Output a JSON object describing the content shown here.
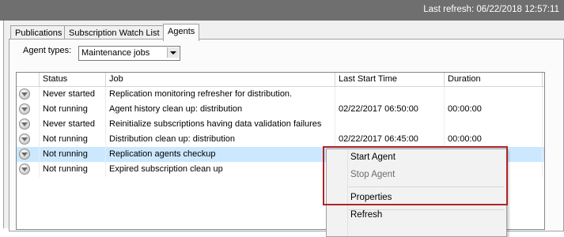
{
  "header": {
    "last_refresh": "Last refresh: 06/22/2018 12:57:11"
  },
  "tabs": [
    {
      "label": "Publications",
      "active": false
    },
    {
      "label": "Subscription Watch List",
      "active": false
    },
    {
      "label": "Agents",
      "active": true
    }
  ],
  "filter": {
    "label": "Agent types:",
    "selected": "Maintenance jobs"
  },
  "grid": {
    "columns": [
      "",
      "Status",
      "Job",
      "Last Start Time",
      "Duration"
    ],
    "rows": [
      {
        "status": "Never started",
        "job": "Replication monitoring refresher for distribution.",
        "last_start": "",
        "duration": "",
        "selected": false
      },
      {
        "status": "Not running",
        "job": "Agent history clean up: distribution",
        "last_start": "02/22/2017 06:50:00",
        "duration": "00:00:00",
        "selected": false
      },
      {
        "status": "Never started",
        "job": "Reinitialize subscriptions having data validation failures",
        "last_start": "",
        "duration": "",
        "selected": false
      },
      {
        "status": "Not running",
        "job": "Distribution clean up: distribution",
        "last_start": "02/22/2017 06:45:00",
        "duration": "00:00:00",
        "selected": false
      },
      {
        "status": "Not running",
        "job": "Replication agents checkup",
        "last_start": "",
        "duration": "",
        "selected": true
      },
      {
        "status": "Not running",
        "job": "Expired subscription clean up",
        "last_start": "",
        "duration": "",
        "selected": false
      }
    ]
  },
  "context_menu": {
    "items": [
      {
        "label": "Start Agent",
        "enabled": true
      },
      {
        "label": "Stop Agent",
        "enabled": false
      },
      {
        "label": "Properties",
        "enabled": true
      },
      {
        "label": "Refresh",
        "enabled": true
      }
    ]
  },
  "colors": {
    "selection": "#cce8ff",
    "annotation_box": "#b22222",
    "titlebar": "#6f6f6f"
  }
}
